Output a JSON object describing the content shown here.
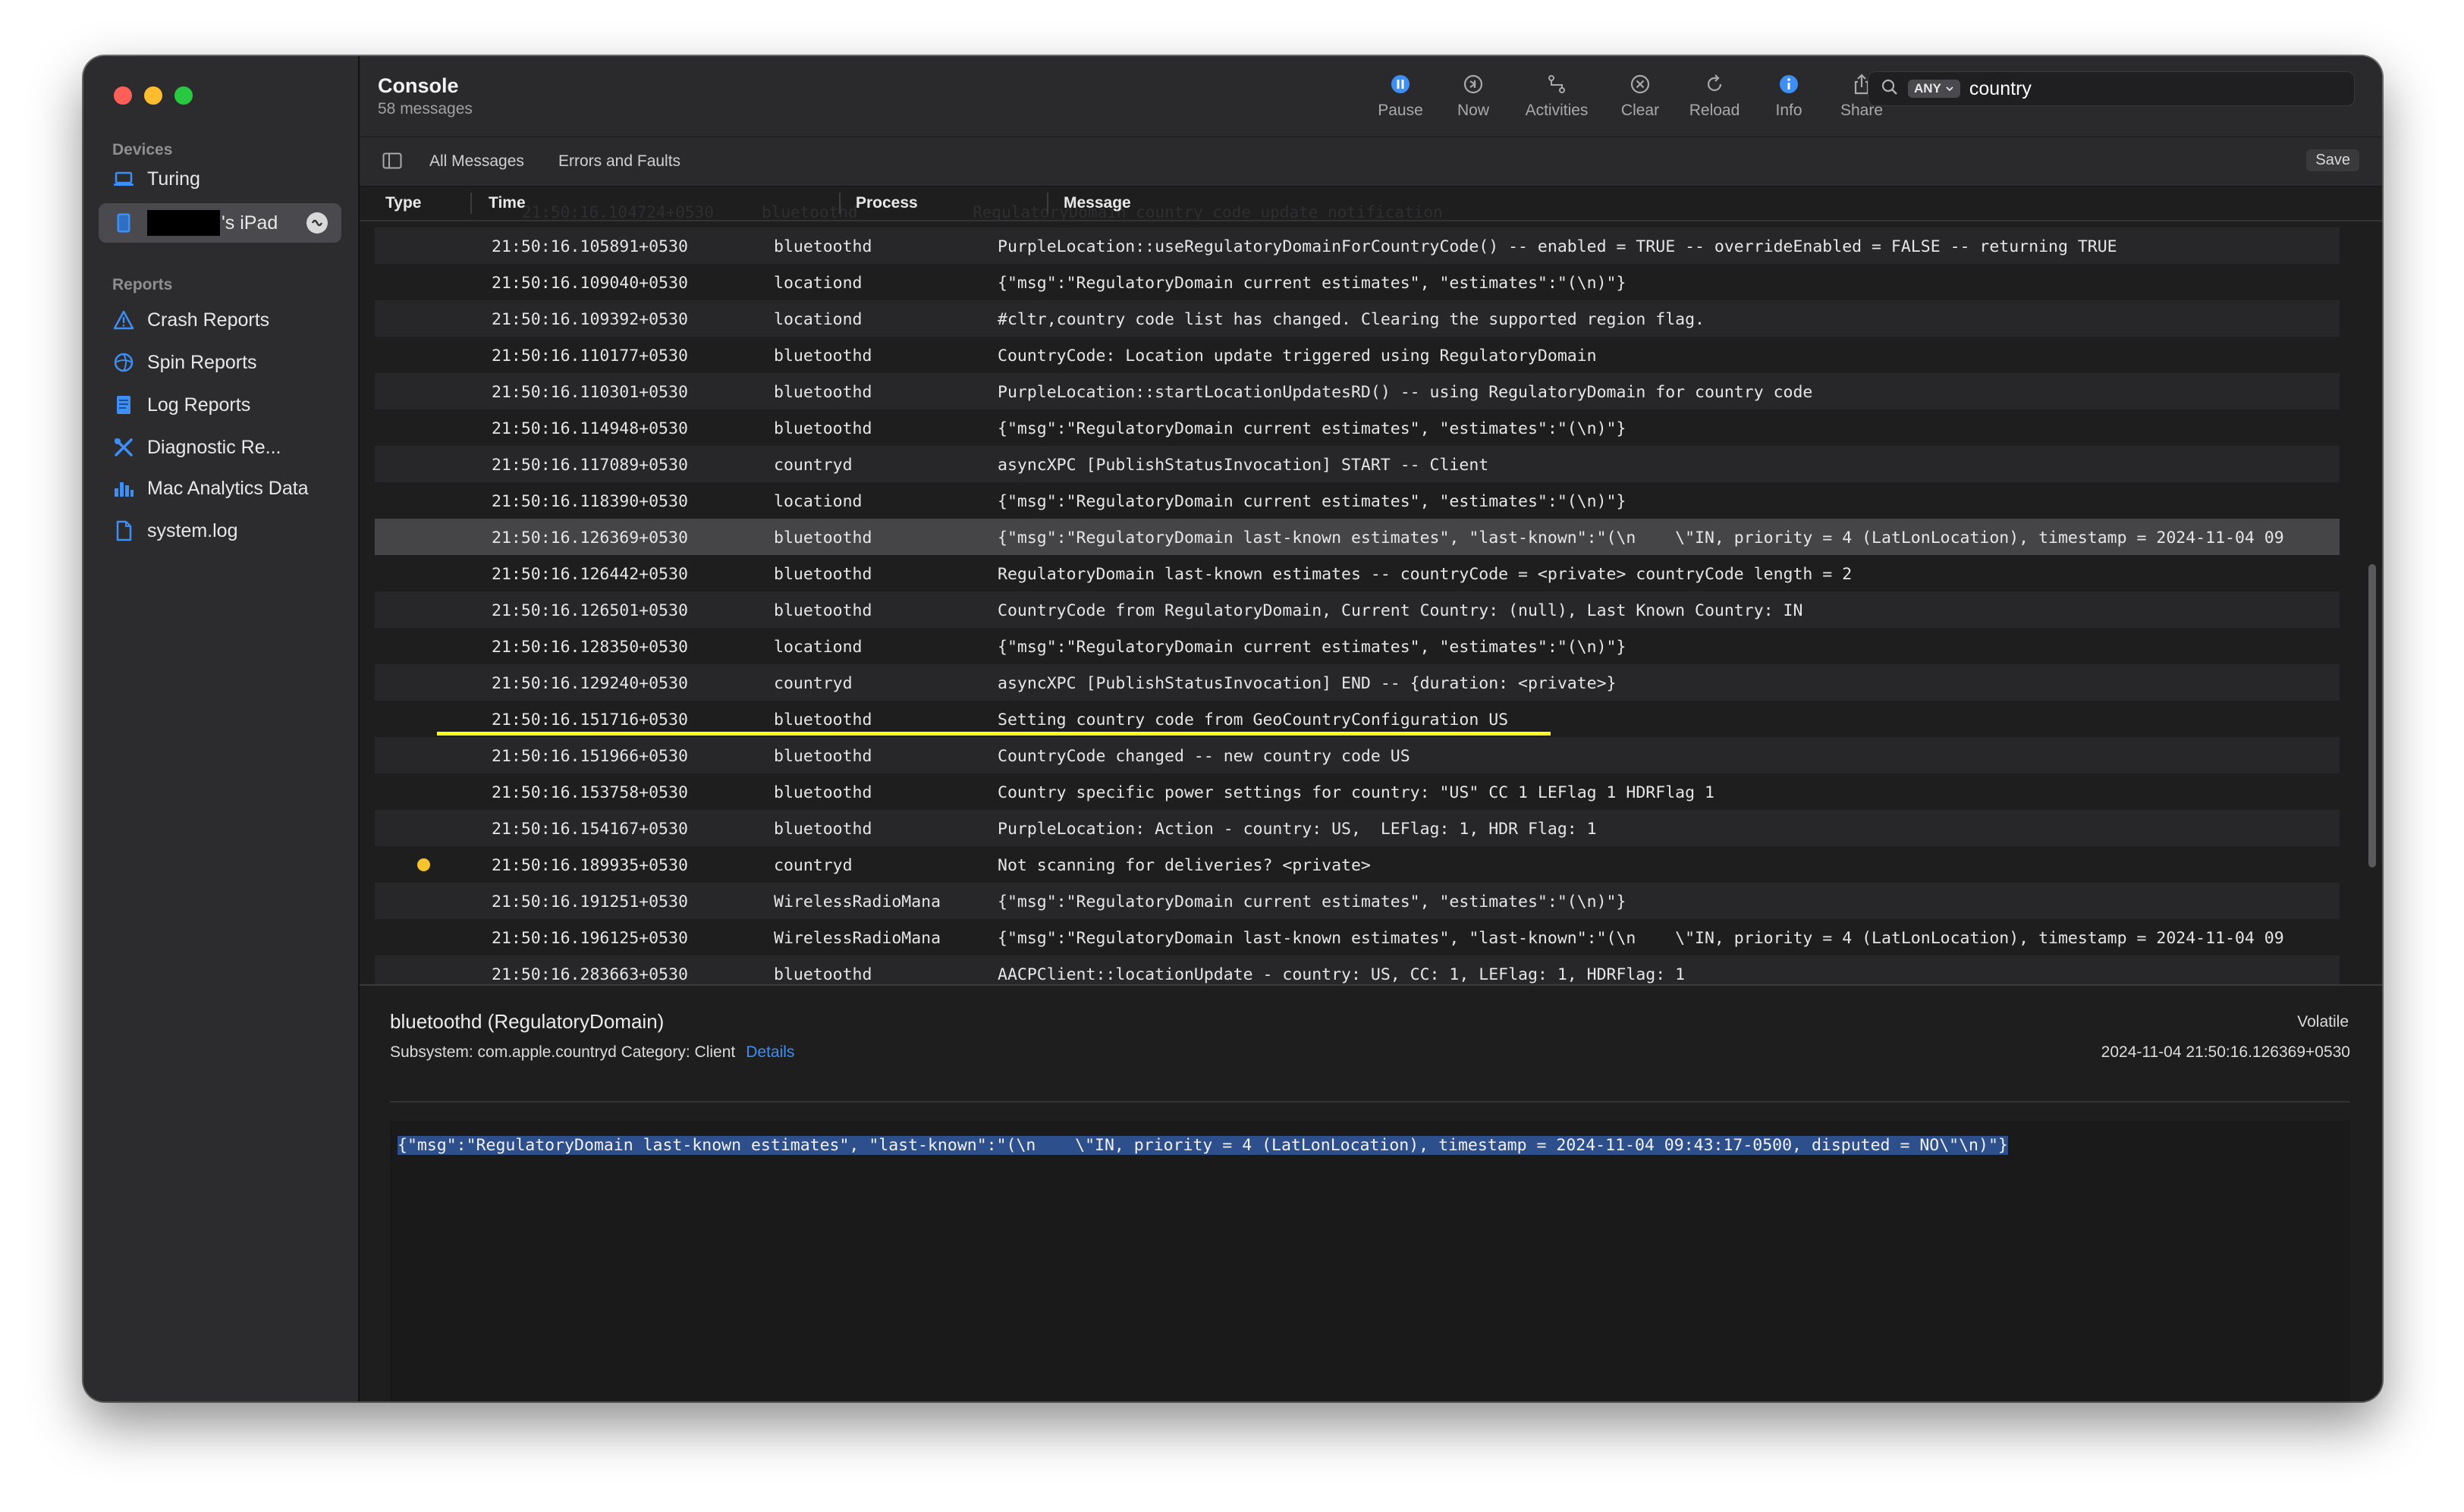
{
  "sidebar": {
    "devices_header": "Devices",
    "devices": [
      {
        "label": "Turing",
        "icon": "laptop-icon"
      },
      {
        "label": "'s iPad",
        "icon": "ipad-icon",
        "redacted": true
      }
    ],
    "reports_header": "Reports",
    "reports": [
      {
        "label": "Crash Reports",
        "icon": "warning-icon"
      },
      {
        "label": "Spin Reports",
        "icon": "spin-icon"
      },
      {
        "label": "Log Reports",
        "icon": "document-icon"
      },
      {
        "label": "Diagnostic Re...",
        "icon": "tools-icon"
      },
      {
        "label": "Mac Analytics Data",
        "icon": "bar-chart-icon"
      },
      {
        "label": "system.log",
        "icon": "file-icon"
      }
    ]
  },
  "header": {
    "title": "Console",
    "subtitle": "58 messages",
    "toolbar": {
      "pause": "Pause",
      "now": "Now",
      "activities": "Activities",
      "clear": "Clear",
      "reload": "Reload",
      "info": "Info",
      "share": "Share"
    },
    "search": {
      "scope": "ANY",
      "value": "country"
    }
  },
  "filters": {
    "all_messages": "All Messages",
    "errors_faults": "Errors and Faults",
    "save": "Save"
  },
  "columns": {
    "type": "Type",
    "time": "Time",
    "process": "Process",
    "message": "Message"
  },
  "ghost_row": "21:50:16.104724+0530     bluetoothd            RegulatoryDomain country code update notification",
  "rows": [
    {
      "time": "21:50:16.105891+0530",
      "process": "bluetoothd",
      "message": "PurpleLocation::useRegulatoryDomainForCountryCode() -- enabled = TRUE -- overrideEnabled = FALSE -- returning TRUE"
    },
    {
      "time": "21:50:16.109040+0530",
      "process": "locationd",
      "message": "{\"msg\":\"RegulatoryDomain current estimates\", \"estimates\":\"(\\n)\"}"
    },
    {
      "time": "21:50:16.109392+0530",
      "process": "locationd",
      "message": "#cltr,country code list has changed. Clearing the supported region flag."
    },
    {
      "time": "21:50:16.110177+0530",
      "process": "bluetoothd",
      "message": "CountryCode: Location update triggered using RegulatoryDomain"
    },
    {
      "time": "21:50:16.110301+0530",
      "process": "bluetoothd",
      "message": "PurpleLocation::startLocationUpdatesRD() -- using RegulatoryDomain for country code"
    },
    {
      "time": "21:50:16.114948+0530",
      "process": "bluetoothd",
      "message": "{\"msg\":\"RegulatoryDomain current estimates\", \"estimates\":\"(\\n)\"}"
    },
    {
      "time": "21:50:16.117089+0530",
      "process": "countryd",
      "message": "asyncXPC [PublishStatusInvocation] START -- Client"
    },
    {
      "time": "21:50:16.118390+0530",
      "process": "locationd",
      "message": "{\"msg\":\"RegulatoryDomain current estimates\", \"estimates\":\"(\\n)\"}"
    },
    {
      "time": "21:50:16.126369+0530",
      "process": "bluetoothd",
      "message": "{\"msg\":\"RegulatoryDomain last-known estimates\", \"last-known\":\"(\\n    \\\"IN, priority = 4 (LatLonLocation), timestamp = 2024-11-04 09",
      "selected": true
    },
    {
      "time": "21:50:16.126442+0530",
      "process": "bluetoothd",
      "message": "RegulatoryDomain last-known estimates -- countryCode = <private> countryCode length = 2"
    },
    {
      "time": "21:50:16.126501+0530",
      "process": "bluetoothd",
      "message": "CountryCode from RegulatoryDomain, Current Country: (null), Last Known Country: IN"
    },
    {
      "time": "21:50:16.128350+0530",
      "process": "locationd",
      "message": "{\"msg\":\"RegulatoryDomain current estimates\", \"estimates\":\"(\\n)\"}"
    },
    {
      "time": "21:50:16.129240+0530",
      "process": "countryd",
      "message": "asyncXPC [PublishStatusInvocation] END -- {duration: <private>}"
    },
    {
      "time": "21:50:16.151716+0530",
      "process": "bluetoothd",
      "message": "Setting country code from GeoCountryConfiguration US",
      "underlined": true
    },
    {
      "time": "21:50:16.151966+0530",
      "process": "bluetoothd",
      "message": "CountryCode changed -- new country code US"
    },
    {
      "time": "21:50:16.153758+0530",
      "process": "bluetoothd",
      "message": "Country specific power settings for country: \"US\" CC 1 LEFlag 1 HDRFlag 1"
    },
    {
      "time": "21:50:16.154167+0530",
      "process": "bluetoothd",
      "message": "PurpleLocation: Action - country: US,  LEFlag: 1, HDR Flag: 1"
    },
    {
      "time": "21:50:16.189935+0530",
      "process": "countryd",
      "message": "Not scanning for deliveries? <private>",
      "type_dot": true
    },
    {
      "time": "21:50:16.191251+0530",
      "process": "WirelessRadioMana",
      "message": "{\"msg\":\"RegulatoryDomain current estimates\", \"estimates\":\"(\\n)\"}"
    },
    {
      "time": "21:50:16.196125+0530",
      "process": "WirelessRadioMana",
      "message": "{\"msg\":\"RegulatoryDomain last-known estimates\", \"last-known\":\"(\\n    \\\"IN, priority = 4 (LatLonLocation), timestamp = 2024-11-04 09"
    },
    {
      "time": "21:50:16.283663+0530",
      "process": "bluetoothd",
      "message": "AACPClient::locationUpdate - country: US, CC: 1, LEFlag: 1, HDRFlag: 1"
    }
  ],
  "detail": {
    "title": "bluetoothd (RegulatoryDomain)",
    "subsystem": "Subsystem: com.apple.countryd  Category: Client",
    "details_link": "Details",
    "volatile": "Volatile",
    "timestamp": "2024-11-04 21:50:16.126369+0530",
    "message": "{\"msg\":\"RegulatoryDomain last-known estimates\", \"last-known\":\"(\\n    \\\"IN, priority = 4 (LatLonLocation), timestamp = 2024-11-04 09:43:17-0500, disputed = NO\\\"\\n)\"}"
  },
  "colors": {
    "accent": "#3d8ff5",
    "selection": "#2d4f8c",
    "underline": "#ffff1a",
    "fault_dot": "#f5c32c"
  }
}
